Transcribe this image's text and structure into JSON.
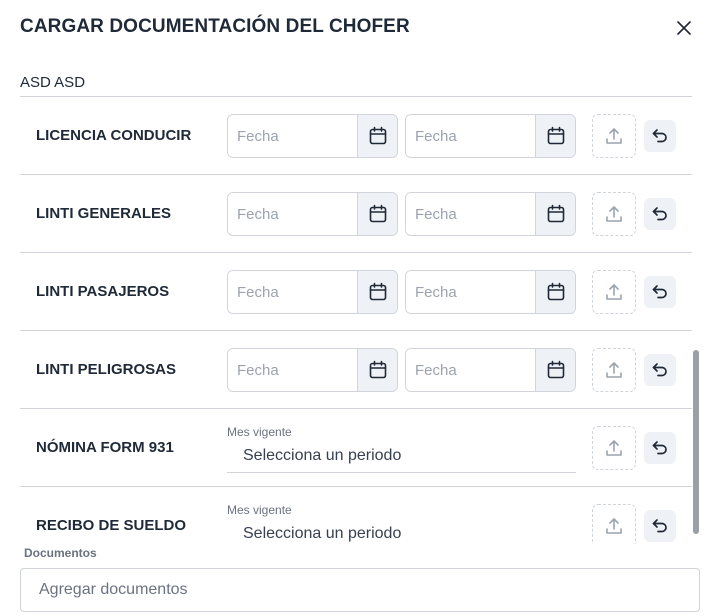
{
  "dialog": {
    "title": "CARGAR DOCUMENTACIÓN DEL CHOFER",
    "driver_name": "ASD ASD"
  },
  "rows": [
    {
      "label": "LICENCIA CONDUCIR",
      "type": "dates",
      "date1_placeholder": "Fecha",
      "date2_placeholder": "Fecha"
    },
    {
      "label": "LINTI GENERALES",
      "type": "dates",
      "date1_placeholder": "Fecha",
      "date2_placeholder": "Fecha"
    },
    {
      "label": "LINTI PASAJEROS",
      "type": "dates",
      "date1_placeholder": "Fecha",
      "date2_placeholder": "Fecha"
    },
    {
      "label": "LINTI PELIGROSAS",
      "type": "dates",
      "date1_placeholder": "Fecha",
      "date2_placeholder": "Fecha"
    },
    {
      "label": "NÓMINA FORM 931",
      "type": "period",
      "period_label": "Mes vigente",
      "period_value": "Selecciona un periodo"
    },
    {
      "label": "RECIBO DE SUELDO",
      "type": "period",
      "period_label": "Mes vigente",
      "period_value": "Selecciona un periodo"
    }
  ],
  "documents": {
    "label": "Documentos",
    "placeholder": "Agregar documentos"
  },
  "icons": {
    "close": "close-icon",
    "calendar": "calendar-icon",
    "upload": "upload-icon",
    "reset": "undo-icon"
  },
  "colors": {
    "text": "#1f2937",
    "border": "#d1d5db",
    "button_bg": "#eef1f5",
    "muted": "#9ca3af"
  }
}
